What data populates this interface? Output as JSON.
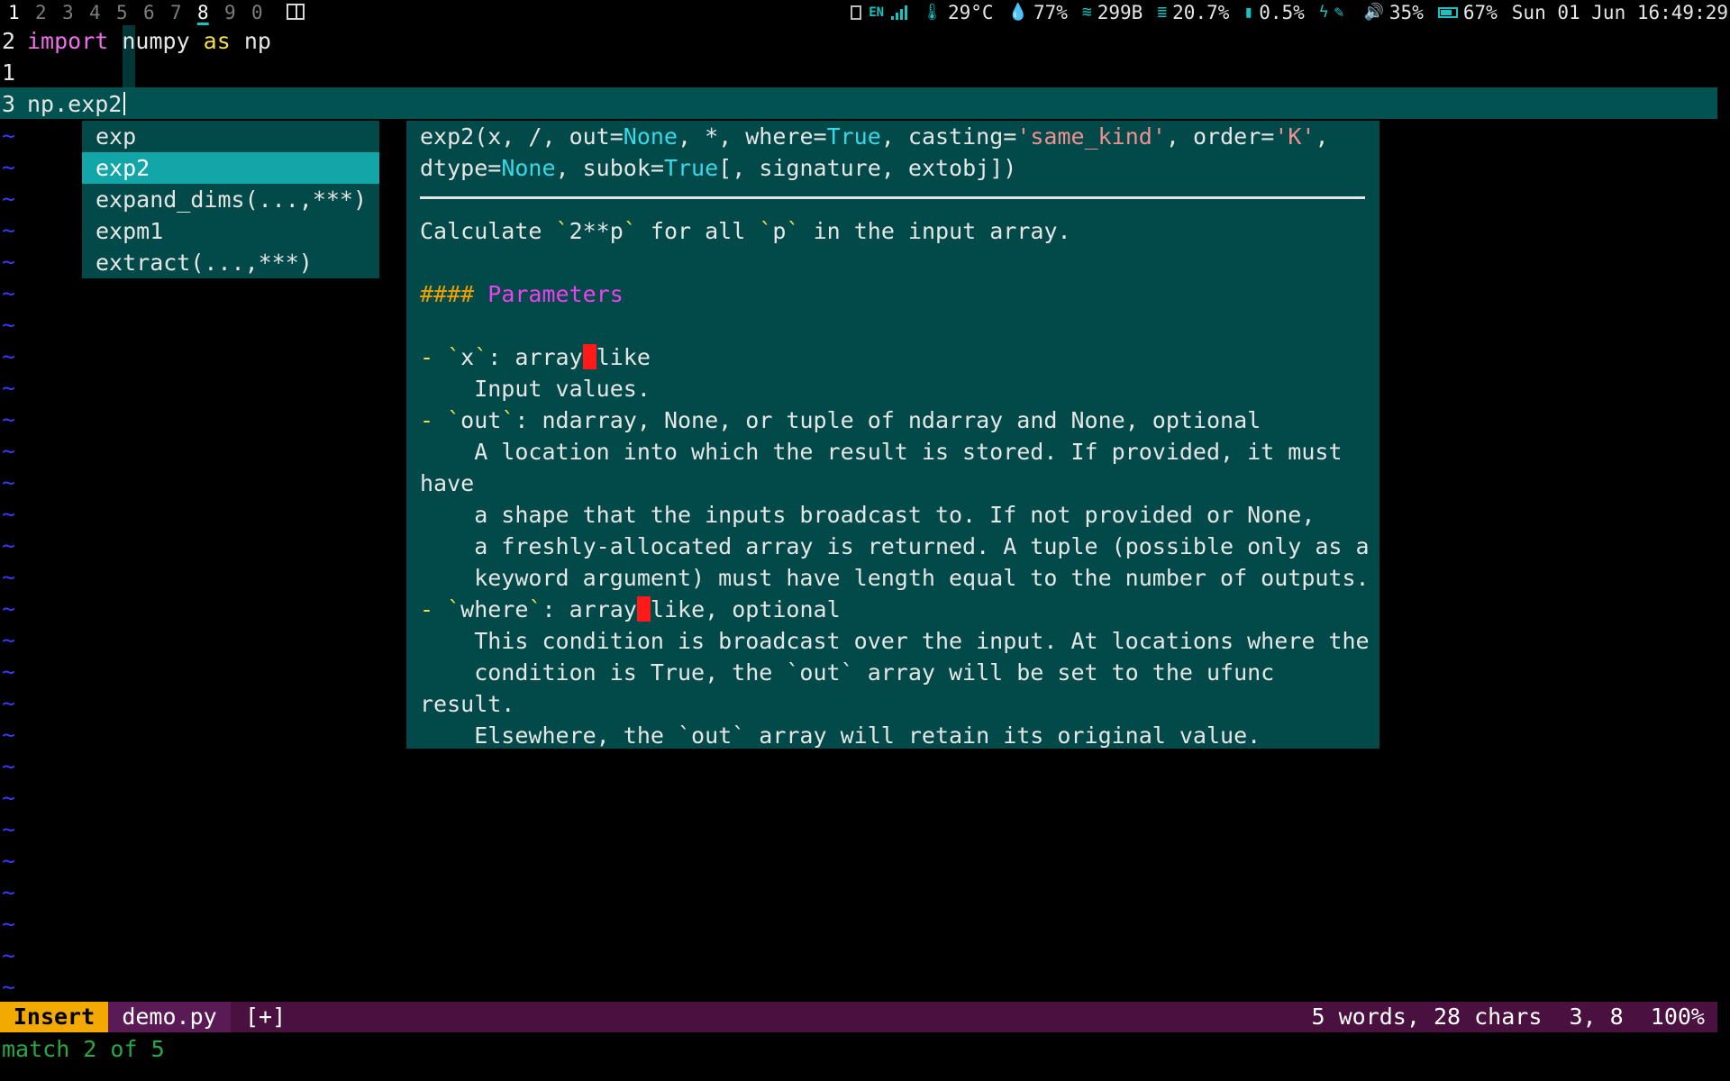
{
  "topbar": {
    "workspaces": [
      "1",
      "2",
      "3",
      "4",
      "5",
      "6",
      "7",
      "8",
      "9",
      "0"
    ],
    "status": {
      "keyboard_lang": "EN",
      "temperature": "29°C",
      "humidity": "77%",
      "network": "299B",
      "disk": "20.7%",
      "cpu": "0.5%",
      "volume": "35%",
      "battery": "67%",
      "datetime": "Sun 01 Jun 16:49:29"
    },
    "icons": [
      "clipboard-icon",
      "signal-bars-icon",
      "thermometer-icon",
      "droplet-icon",
      "wifi-icon",
      "database-icon",
      "cpu-icon",
      "bolt-icon",
      "microphone-muted-icon",
      "speaker-icon",
      "battery-icon",
      "layout-icon"
    ]
  },
  "editor": {
    "lines": [
      {
        "num": "2",
        "parts": [
          {
            "t": "import",
            "c": "kw"
          },
          {
            "t": " numpy ",
            "c": ""
          },
          {
            "t": "as",
            "c": "kw2"
          },
          {
            "t": " np",
            "c": ""
          }
        ]
      },
      {
        "num": "1",
        "parts": []
      },
      {
        "num": "3",
        "parts": [
          {
            "t": "np.exp2",
            "c": ""
          }
        ]
      }
    ],
    "tilde": "~"
  },
  "completion": {
    "items": [
      "exp",
      "exp2",
      "expand_dims(...,***)",
      "expm1",
      "extract(...,***)"
    ],
    "selected_index": 1
  },
  "doc": {
    "signature_1": [
      {
        "t": "exp2(x, /, out=",
        "c": ""
      },
      {
        "t": "None",
        "c": "cy"
      },
      {
        "t": ", *, where=",
        "c": ""
      },
      {
        "t": "True",
        "c": "cy"
      },
      {
        "t": ", casting=",
        "c": ""
      },
      {
        "t": "'same_kind'",
        "c": "sq"
      },
      {
        "t": ", order=",
        "c": ""
      },
      {
        "t": "'K'",
        "c": "sq"
      },
      {
        "t": ",",
        "c": ""
      }
    ],
    "signature_2": [
      {
        "t": "dtype=",
        "c": ""
      },
      {
        "t": "None",
        "c": "cy"
      },
      {
        "t": ", subok=",
        "c": ""
      },
      {
        "t": "True",
        "c": "cy"
      },
      {
        "t": "[, signature, extobj])",
        "c": ""
      }
    ],
    "body": [
      {
        "row": 3,
        "parts": [
          {
            "t": "Calculate ",
            "c": ""
          },
          {
            "t": "`",
            "c": "yl"
          },
          {
            "t": "2**p",
            "c": ""
          },
          {
            "t": "`",
            "c": "yl"
          },
          {
            "t": " for all ",
            "c": ""
          },
          {
            "t": "`",
            "c": "yl"
          },
          {
            "t": "p",
            "c": ""
          },
          {
            "t": "`",
            "c": "yl"
          },
          {
            "t": " in the input array.",
            "c": ""
          }
        ]
      },
      {
        "row": 5,
        "parts": [
          {
            "t": "####",
            "c": "or"
          },
          {
            "t": " ",
            "c": ""
          },
          {
            "t": "Parameters",
            "c": "mg"
          }
        ]
      },
      {
        "row": 7,
        "parts": [
          {
            "t": "- ",
            "c": "yl"
          },
          {
            "t": "`",
            "c": "yl"
          },
          {
            "t": "x",
            "c": ""
          },
          {
            "t": "`",
            "c": "yl"
          },
          {
            "t": ": array",
            "c": ""
          },
          {
            "t": "_",
            "c": "red"
          },
          {
            "t": "like",
            "c": ""
          }
        ]
      },
      {
        "row": 8,
        "parts": [
          {
            "t": "    Input values.",
            "c": ""
          }
        ]
      },
      {
        "row": 9,
        "parts": [
          {
            "t": "- ",
            "c": "yl"
          },
          {
            "t": "`",
            "c": "yl"
          },
          {
            "t": "out",
            "c": ""
          },
          {
            "t": "`",
            "c": "yl"
          },
          {
            "t": ": ndarray, None, or tuple of ndarray and None, optional",
            "c": ""
          }
        ]
      },
      {
        "row": 10,
        "parts": [
          {
            "t": "    A location into which the result is stored. If provided, it must",
            "c": ""
          }
        ]
      },
      {
        "row": 11,
        "parts": [
          {
            "t": "have",
            "c": ""
          }
        ]
      },
      {
        "row": 12,
        "parts": [
          {
            "t": "    a shape that the inputs broadcast to. If not provided or None,",
            "c": ""
          }
        ]
      },
      {
        "row": 13,
        "parts": [
          {
            "t": "    a freshly-allocated array is returned. A tuple (possible only as a",
            "c": ""
          }
        ]
      },
      {
        "row": 14,
        "parts": [
          {
            "t": "    keyword argument) must have length equal to the number of outputs.",
            "c": ""
          }
        ]
      },
      {
        "row": 15,
        "parts": [
          {
            "t": "- ",
            "c": "yl"
          },
          {
            "t": "`",
            "c": "yl"
          },
          {
            "t": "where",
            "c": ""
          },
          {
            "t": "`",
            "c": "yl"
          },
          {
            "t": ": array",
            "c": ""
          },
          {
            "t": "_",
            "c": "red"
          },
          {
            "t": "like, optional",
            "c": ""
          }
        ]
      },
      {
        "row": 16,
        "parts": [
          {
            "t": "    This condition is broadcast over the input. At locations where the",
            "c": ""
          }
        ]
      },
      {
        "row": 17,
        "parts": [
          {
            "t": "    condition is True, the `out` array will be set to the ufunc",
            "c": ""
          }
        ]
      },
      {
        "row": 18,
        "parts": [
          {
            "t": "result.",
            "c": ""
          }
        ]
      },
      {
        "row": 19,
        "parts": [
          {
            "t": "    Elsewhere, the `out` array will retain its original value.",
            "c": ""
          }
        ]
      }
    ]
  },
  "statusline": {
    "mode": "Insert",
    "filename": "demo.py",
    "modified": "[+]",
    "right": "5 words, 28 chars  3, 8  100%"
  },
  "message": "match 2 of 5"
}
